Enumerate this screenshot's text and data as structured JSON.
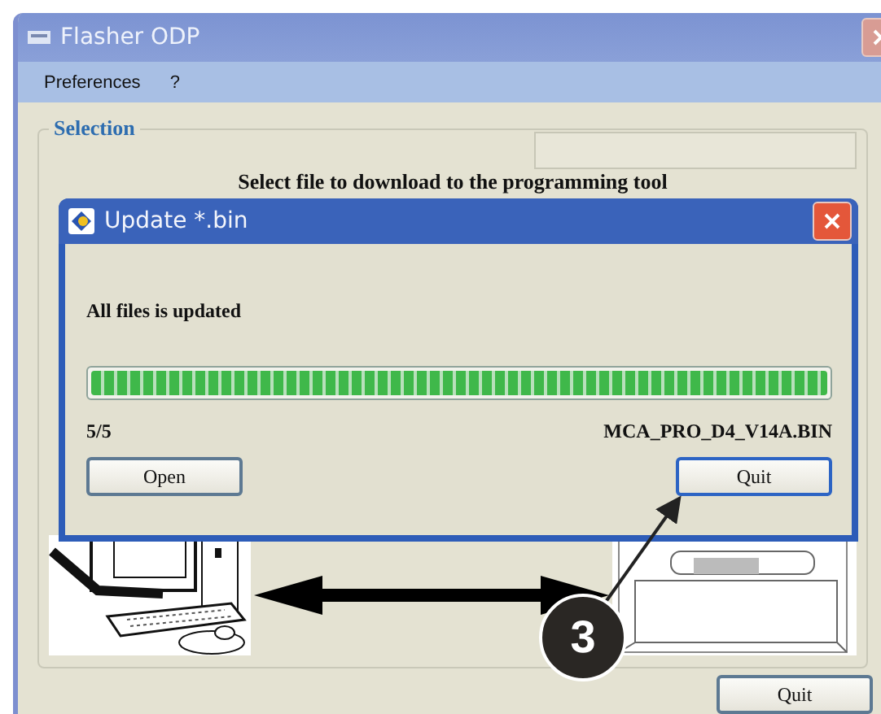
{
  "main_window": {
    "title": "Flasher ODP",
    "menu": [
      "Preferences",
      "?"
    ],
    "selection": {
      "legend": "Selection",
      "instruction": "Select file to download to the programming tool"
    },
    "quit_button": "Quit"
  },
  "dialog": {
    "title": "Update *.bin",
    "message": "All files is updated",
    "progress": {
      "level": 1
    },
    "count": "5/5",
    "file": "MCA_PRO_D4_V14A.BIN",
    "buttons": [
      "Open",
      "Quit"
    ]
  },
  "callout": {
    "number": "3"
  }
}
